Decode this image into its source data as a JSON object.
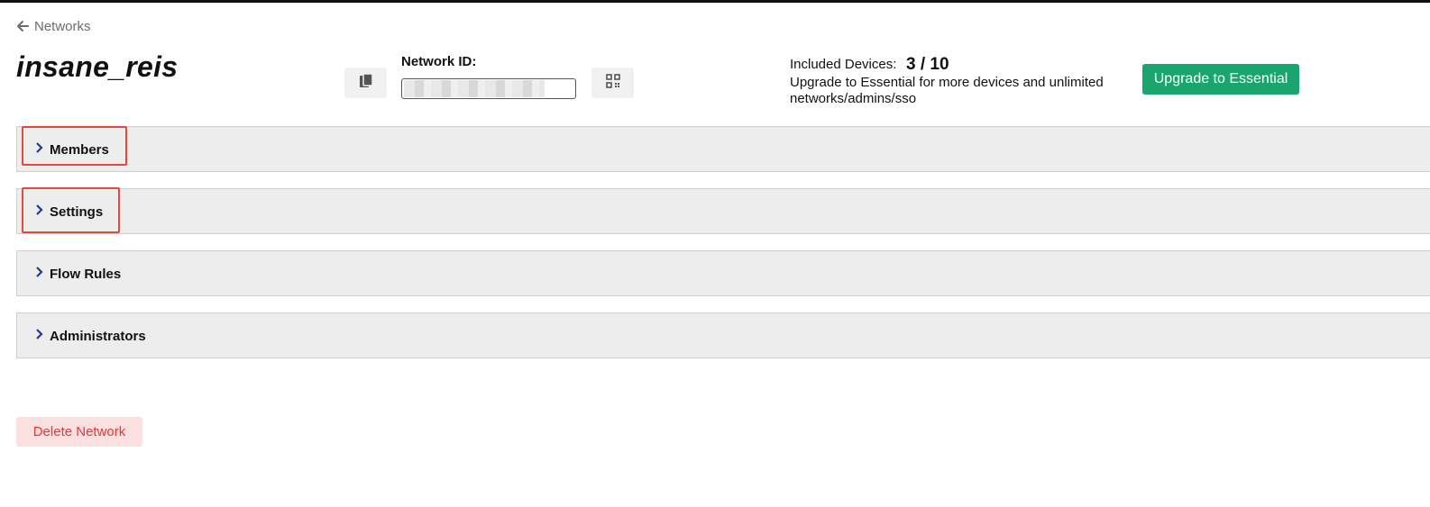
{
  "nav": {
    "back_label": "Networks"
  },
  "network": {
    "name": "insane_reis",
    "id_label": "Network ID:",
    "id_value": ""
  },
  "plan": {
    "devices_label": "Included Devices:",
    "devices_count": "3 / 10",
    "upgrade_text": "Upgrade to Essential for more devices and unlimited networks/admins/sso",
    "upgrade_button": "Upgrade to Essential"
  },
  "sections": [
    {
      "label": "Members",
      "highlighted": true
    },
    {
      "label": "Settings",
      "highlighted": true
    },
    {
      "label": "Flow Rules",
      "highlighted": false
    },
    {
      "label": "Administrators",
      "highlighted": false
    }
  ],
  "actions": {
    "delete_label": "Delete Network"
  },
  "colors": {
    "accent_green": "#1aa56f",
    "danger_text": "#e0383a",
    "danger_bg": "#fbe0e0",
    "chevron": "#1f3a93",
    "highlight_border": "#e04a3f"
  },
  "icons": [
    "back-arrow-icon",
    "copy-icon",
    "qr-code-icon",
    "chevron-right-icon"
  ]
}
